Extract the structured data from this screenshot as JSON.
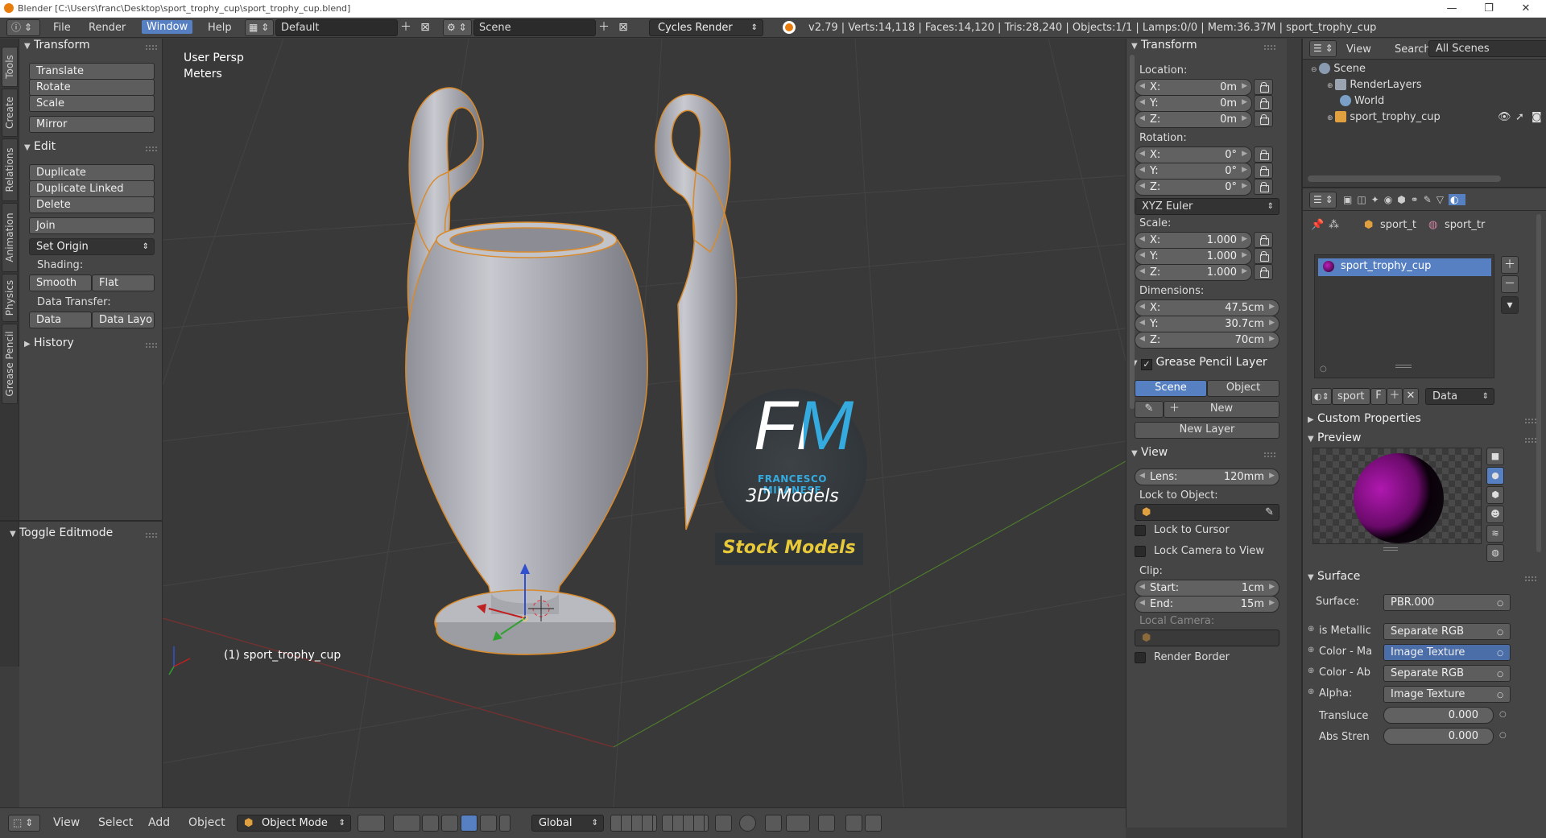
{
  "window": {
    "title": "Blender  [C:\\Users\\franc\\Desktop\\sport_trophy_cup\\sport_trophy_cup.blend]",
    "min": "—",
    "max": "❐",
    "close": "✕"
  },
  "info": {
    "menus": [
      "File",
      "Render",
      "Window",
      "Help"
    ],
    "active_menu": "Window",
    "layout": "Default",
    "scene": "Scene",
    "engine": "Cycles Render",
    "stats": "v2.79 | Verts:14,118 | Faces:14,120 | Tris:28,240 | Objects:1/1 | Lamps:0/0 | Mem:36.37M | sport_trophy_cup"
  },
  "vtabs": [
    "Tools",
    "Create",
    "Relations",
    "Animation",
    "Physics",
    "Grease Pencil"
  ],
  "toolshelf": {
    "transform_header": "Transform",
    "translate": "Translate",
    "rotate": "Rotate",
    "scale": "Scale",
    "mirror": "Mirror",
    "edit_header": "Edit",
    "duplicate": "Duplicate",
    "duplicate_linked": "Duplicate Linked",
    "delete": "Delete",
    "join": "Join",
    "set_origin": "Set Origin",
    "shading_label": "Shading:",
    "smooth": "Smooth",
    "flat": "Flat",
    "data_transfer_label": "Data Transfer:",
    "data": "Data",
    "data_layo": "Data Layo",
    "history": "History",
    "toggle_editmode": "Toggle Editmode"
  },
  "viewport": {
    "view_name": "User Persp",
    "units": "Meters",
    "object_label": "(1) sport_trophy_cup",
    "logo": {
      "initials": "FM",
      "author": "FRANCESCO MILANESE",
      "subtitle": "3D Models",
      "banner": "Stock Models"
    }
  },
  "npanel": {
    "transform_header": "Transform",
    "location_label": "Location:",
    "loc_x": "0m",
    "loc_y": "0m",
    "loc_z": "0m",
    "rotation_label": "Rotation:",
    "rot_x": "0°",
    "rot_y": "0°",
    "rot_z": "0°",
    "rotation_mode": "XYZ Euler",
    "scale_label": "Scale:",
    "scale_x": "1.000",
    "scale_y": "1.000",
    "scale_z": "1.000",
    "dimensions_label": "Dimensions:",
    "dim_x": "47.5cm",
    "dim_y": "30.7cm",
    "dim_z": "70cm",
    "axis_x": "X:",
    "axis_y": "Y:",
    "axis_z": "Z:",
    "gp_header": "Grease Pencil Layer",
    "gp_scene": "Scene",
    "gp_object": "Object",
    "gp_new": "New",
    "gp_new_layer": "New Layer",
    "view_header": "View",
    "lens_label": "Lens:",
    "lens": "120mm",
    "lock_object_label": "Lock to Object:",
    "lock_cursor": "Lock to Cursor",
    "lock_camera": "Lock Camera to View",
    "clip_label": "Clip:",
    "start_label": "Start:",
    "clip_start": "1cm",
    "end_label": "End:",
    "clip_end": "15m",
    "local_camera_label": "Local Camera:",
    "render_border": "Render Border"
  },
  "outliner": {
    "view": "View",
    "search": "Search",
    "filter": "All Scenes",
    "items": [
      "Scene",
      "RenderLayers",
      "World",
      "sport_trophy_cup"
    ]
  },
  "properties": {
    "crumb1": "sport_t",
    "crumb2": "sport_tr",
    "material": "sport_trophy_cup",
    "mat_short": "sport",
    "fake": "F",
    "data_dropdown": "Data",
    "custom_props": "Custom Properties",
    "preview": "Preview",
    "surface_header": "Surface",
    "surface_label": "Surface:",
    "surface_value": "PBR.000",
    "rows": [
      {
        "label": "is Metallic",
        "value": "Separate RGB"
      },
      {
        "label": "Color - Ma",
        "value": "Image Texture"
      },
      {
        "label": "Color - Ab",
        "value": "Separate RGB"
      },
      {
        "label": "Alpha:",
        "value": "Image Texture"
      }
    ],
    "translucency_label": "Transluce",
    "translucency": "0.000",
    "abs_label": "Abs Stren",
    "abs": "0.000"
  },
  "bottom": {
    "menus": [
      "View",
      "Select",
      "Add",
      "Object"
    ],
    "mode": "Object Mode",
    "orientation": "Global"
  },
  "colors": {
    "accent": "#5680c2",
    "bg": "#393939",
    "panel": "#454545"
  }
}
